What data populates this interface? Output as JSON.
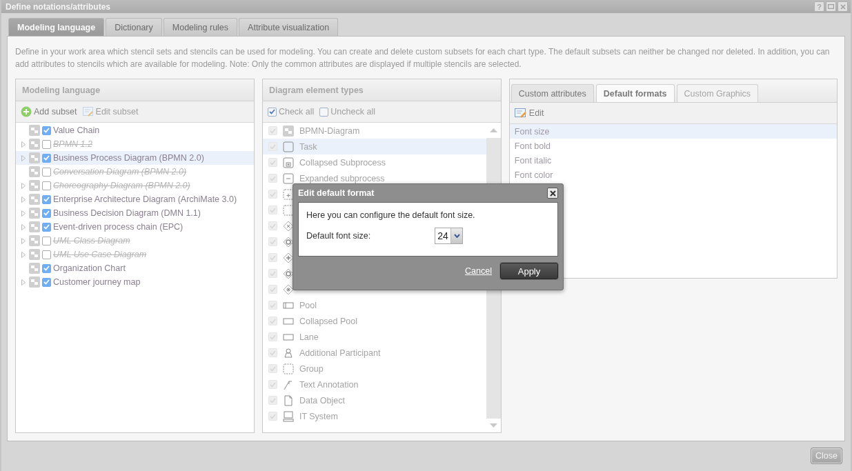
{
  "window": {
    "title": "Define notations/attributes",
    "help": "?"
  },
  "tabs": [
    {
      "label": "Modeling language",
      "selected": true
    },
    {
      "label": "Dictionary",
      "selected": false
    },
    {
      "label": "Modeling rules",
      "selected": false
    },
    {
      "label": "Attribute visualization",
      "selected": false
    }
  ],
  "description": "Define in your work area which stencil sets and stencils can be used for modeling. You can create and delete custom subsets for each chart type. The default subsets can neither be changed nor deleted. In addition, you can add attributes to stencils which are available for modeling. Note: Only the common attributes are displayed if multiple stencils are selected.",
  "language_panel": {
    "title": "Modeling language",
    "toolbar": [
      {
        "label": "Add subset",
        "kind": "add",
        "disabled": false
      },
      {
        "label": "Edit subset",
        "kind": "edit",
        "disabled": true
      }
    ],
    "items": [
      {
        "label": "Value Chain",
        "expandable": false,
        "checked": true,
        "deprecated": false,
        "selected": false
      },
      {
        "label": "BPMN 1.2",
        "expandable": true,
        "checked": false,
        "deprecated": true,
        "selected": false
      },
      {
        "label": "Business Process Diagram (BPMN 2.0)",
        "expandable": true,
        "checked": true,
        "deprecated": false,
        "selected": true
      },
      {
        "label": "Conversation Diagram (BPMN 2.0)",
        "expandable": false,
        "checked": false,
        "deprecated": true,
        "selected": false
      },
      {
        "label": "Choreography Diagram (BPMN 2.0)",
        "expandable": true,
        "checked": false,
        "deprecated": true,
        "selected": false
      },
      {
        "label": "Enterprise Architecture Diagram (ArchiMate 3.0)",
        "expandable": true,
        "checked": true,
        "deprecated": false,
        "selected": false
      },
      {
        "label": "Business Decision Diagram (DMN 1.1)",
        "expandable": true,
        "checked": true,
        "deprecated": false,
        "selected": false
      },
      {
        "label": "Event-driven process chain (EPC)",
        "expandable": true,
        "checked": true,
        "deprecated": false,
        "selected": false
      },
      {
        "label": "UML Class Diagram",
        "expandable": true,
        "checked": false,
        "deprecated": true,
        "selected": false
      },
      {
        "label": "UML Use Case Diagram",
        "expandable": true,
        "checked": false,
        "deprecated": true,
        "selected": false
      },
      {
        "label": "Organization Chart",
        "expandable": false,
        "checked": true,
        "deprecated": false,
        "selected": false
      },
      {
        "label": "Customer journey map",
        "expandable": true,
        "checked": true,
        "deprecated": false,
        "selected": false
      }
    ]
  },
  "element_panel": {
    "title": "Diagram element types",
    "toolbar": [
      {
        "label": "Check all",
        "checked": true
      },
      {
        "label": "Uncheck all",
        "checked": false
      }
    ],
    "items": [
      {
        "label": "BPMN-Diagram",
        "kind": "diagram",
        "checked": true,
        "selected": false
      },
      {
        "label": "Task",
        "kind": "task",
        "checked": true,
        "selected": true
      },
      {
        "label": "Collapsed Subprocess",
        "kind": "collapsed",
        "checked": true,
        "selected": false
      },
      {
        "label": "Expanded subprocess",
        "kind": "expanded",
        "checked": true,
        "selected": false
      },
      {
        "kind": "dashedplus",
        "checked": true,
        "selected": false
      },
      {
        "kind": "dashed",
        "checked": true,
        "selected": false
      },
      {
        "kind": "exclusive",
        "checked": true,
        "selected": false
      },
      {
        "kind": "ring",
        "checked": true,
        "selected": false
      },
      {
        "kind": "parallel",
        "checked": true,
        "selected": false
      },
      {
        "kind": "ring",
        "checked": true,
        "selected": false
      },
      {
        "kind": "complex",
        "checked": true,
        "selected": false
      },
      {
        "label": "Pool",
        "kind": "pool",
        "checked": true,
        "selected": false
      },
      {
        "label": "Collapsed Pool",
        "kind": "rect",
        "checked": true,
        "selected": false
      },
      {
        "label": "Lane",
        "kind": "rect",
        "checked": true,
        "selected": false
      },
      {
        "label": "Additional Participant",
        "kind": "participant",
        "checked": true,
        "selected": false
      },
      {
        "label": "Group",
        "kind": "dashed",
        "checked": true,
        "selected": false
      },
      {
        "label": "Text Annotation",
        "kind": "annotation",
        "checked": true,
        "selected": false
      },
      {
        "label": "Data Object",
        "kind": "document",
        "checked": true,
        "selected": false
      },
      {
        "label": "IT System",
        "kind": "computer",
        "checked": true,
        "selected": false
      }
    ]
  },
  "format_panel": {
    "tabs": [
      {
        "label": "Custom attributes",
        "selected": false,
        "disabled": false
      },
      {
        "label": "Default formats",
        "selected": true,
        "disabled": false
      },
      {
        "label": "Custom Graphics",
        "selected": false,
        "disabled": true
      }
    ],
    "edit": "Edit",
    "items": [
      {
        "label": "Font size",
        "selected": true
      },
      {
        "label": "Font bold",
        "selected": false
      },
      {
        "label": "Font italic",
        "selected": false
      },
      {
        "label": "Font color",
        "selected": false
      }
    ]
  },
  "dialog": {
    "title": "Edit default format",
    "message": "Here you can configure the default font size.",
    "field_label": "Default font size:",
    "value": "24",
    "cancel": "Cancel",
    "apply": "Apply"
  },
  "close_button": "Close"
}
